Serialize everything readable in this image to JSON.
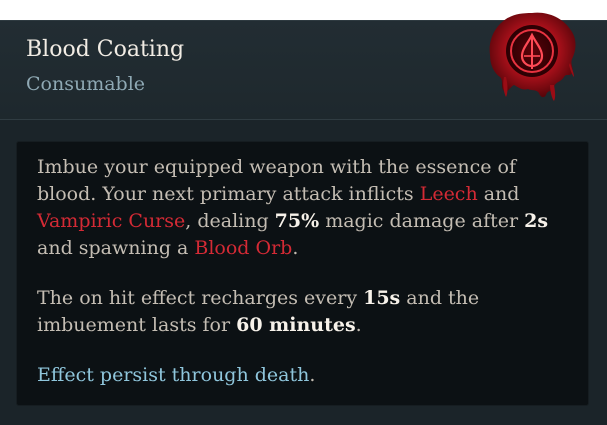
{
  "item": {
    "name": "Blood Coating",
    "type": "Consumable"
  },
  "icon": {
    "name": "blood-drop-icon",
    "color": "#b1151f"
  },
  "description": {
    "p1": {
      "t1": "Imbue your equipped weapon with the essence of blood. Your next primary attack inflicts ",
      "leech": "Leech",
      "t2": " and ",
      "curse": "Vampiric Curse",
      "t3": ", dealing ",
      "damage": "75%",
      "t4": " magic damage after ",
      "delay": "2s",
      "t5": " and spawning a ",
      "orb": "Blood Orb",
      "t6": "."
    },
    "p2": {
      "t1": "The on hit effect recharges every ",
      "recharge": "15s",
      "t2": " and the imbuement lasts for ",
      "duration": "60 minutes",
      "t3": "."
    },
    "p3": {
      "text": "Effect persist through death",
      "end": "."
    }
  },
  "colors": {
    "keyword_red": "#d42a35",
    "highlight_white": "#f7f2ea",
    "note_blue": "#8fc6dc"
  }
}
